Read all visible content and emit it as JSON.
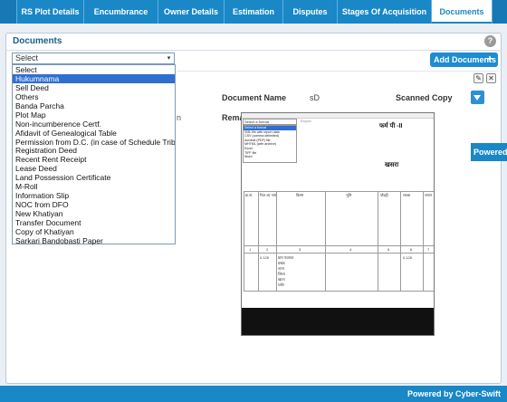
{
  "tabs": [
    {
      "label": ""
    },
    {
      "label": "RS Plot Details"
    },
    {
      "label": "Encumbrance"
    },
    {
      "label": "Owner Details"
    },
    {
      "label": "Estimation"
    },
    {
      "label": "Disputes"
    },
    {
      "label": "Stages Of Acquisition"
    },
    {
      "label": "Documents"
    },
    {
      "label": ""
    }
  ],
  "panel": {
    "title": "Documents",
    "help_icon": "?",
    "add_button": "Add Documents",
    "add_icon": "+"
  },
  "document_type_select": {
    "selected": "Select",
    "arrow": "▾",
    "options": [
      "Select",
      "Hukumnama",
      "Sell Deed",
      "Others",
      "Banda Parcha",
      "Plot Map",
      "Non-incumberence Certf.",
      "Afidavit of Genealogical Table",
      "Permission from D.C. (in case of Schedule Tribe)",
      "Registration Deed",
      "Recent Rent Receipt",
      "Lease Deed",
      "Land Possession Certificate",
      "M-Roll",
      "Information Slip",
      "NOC from DFO",
      "New Khatiyan",
      "Transfer Document",
      "Copy of Khatiyan",
      "Sarkari Bandobasti Paper"
    ],
    "highlighted_index": 1
  },
  "record": {
    "document_name_label": "Document Name",
    "document_name_value": "sD",
    "scanned_copy_label": "Scanned Copy",
    "remarks_label": "Rema",
    "left_fragment": "n",
    "edit_icon": "✎",
    "delete_icon": "✕"
  },
  "doc_viewer": {
    "format_select": "Select a format",
    "export_label": "Export",
    "formats": [
      "Select a format",
      "XML file with report data",
      "CSV (comma delimited)",
      "Acrobat (PDF) file",
      "MHTML (web archive)",
      "Excel",
      "TIFF file",
      "Word"
    ],
    "title": "फर्म पी -II",
    "subtitle": "खसरा",
    "col_numbers": [
      "1",
      "2",
      "3",
      "4",
      "5",
      "6",
      "7",
      "8"
    ],
    "row_value": "0.125",
    "head_cells": [
      "क्र.सं.",
      "रैयत का नाम",
      "किस्म",
      "भूमि",
      "चौहद्दी",
      "रकबा",
      "लगान",
      "दर"
    ],
    "body_text": [
      "ग्राम पंचायत",
      "प्रखंड",
      "थाना",
      "जिला",
      "खाता",
      "प्लॉट"
    ]
  },
  "powered_mid": "Powered by Cyber-Swift",
  "footer": "Powered by Cyber-Swift"
}
